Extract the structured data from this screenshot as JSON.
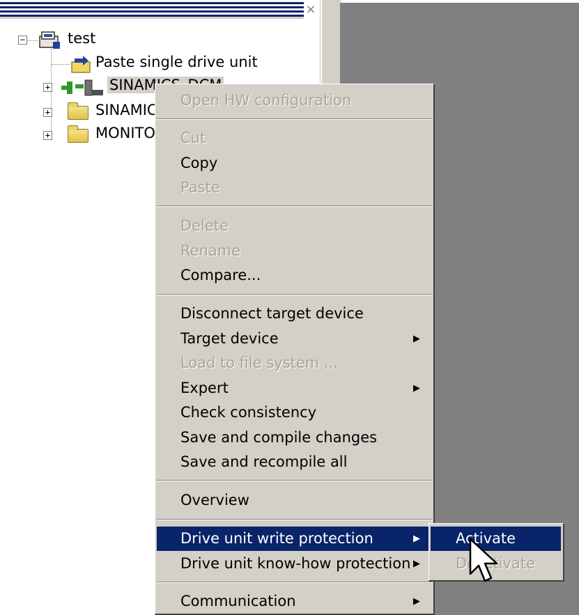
{
  "tree": {
    "root_label": "test",
    "items": [
      {
        "label": "Paste single drive unit",
        "icon": "paste-icon"
      },
      {
        "label": "SINAMICS_DCM",
        "icon": "drive-unit-icon"
      },
      {
        "label": "SINAMICS",
        "icon": "folder-icon"
      },
      {
        "label": "MONITOR",
        "icon": "folder-icon"
      }
    ]
  },
  "context_menu": {
    "items": [
      {
        "label": "Open HW configuration",
        "enabled": false
      },
      {
        "label": "Cut",
        "enabled": false
      },
      {
        "label": "Copy",
        "enabled": true
      },
      {
        "label": "Paste",
        "enabled": false
      },
      {
        "label": "Delete",
        "enabled": false
      },
      {
        "label": "Rename",
        "enabled": false
      },
      {
        "label": "Compare...",
        "enabled": true
      },
      {
        "label": "Disconnect target device",
        "enabled": true
      },
      {
        "label": "Target device",
        "enabled": true,
        "submenu": true
      },
      {
        "label": "Load to file system ...",
        "enabled": false
      },
      {
        "label": "Expert",
        "enabled": true,
        "submenu": true
      },
      {
        "label": "Check consistency",
        "enabled": true
      },
      {
        "label": "Save and compile changes",
        "enabled": true
      },
      {
        "label": "Save and recompile all",
        "enabled": true
      },
      {
        "label": "Overview",
        "enabled": true
      },
      {
        "label": "Drive unit write protection",
        "enabled": true,
        "submenu": true,
        "highlighted": true
      },
      {
        "label": "Drive unit know-how protection",
        "enabled": true,
        "submenu": true
      },
      {
        "label": "Communication",
        "enabled": true,
        "submenu": true
      }
    ],
    "submenu_arrow": "▶"
  },
  "submenu": {
    "items": [
      {
        "label": "Activate",
        "enabled": true,
        "highlighted": true
      },
      {
        "label": "Deactivate",
        "enabled": false
      }
    ]
  },
  "colors": {
    "menu_bg": "#d4d0c8",
    "highlight": "#0a246a",
    "work_area": "#808080"
  }
}
